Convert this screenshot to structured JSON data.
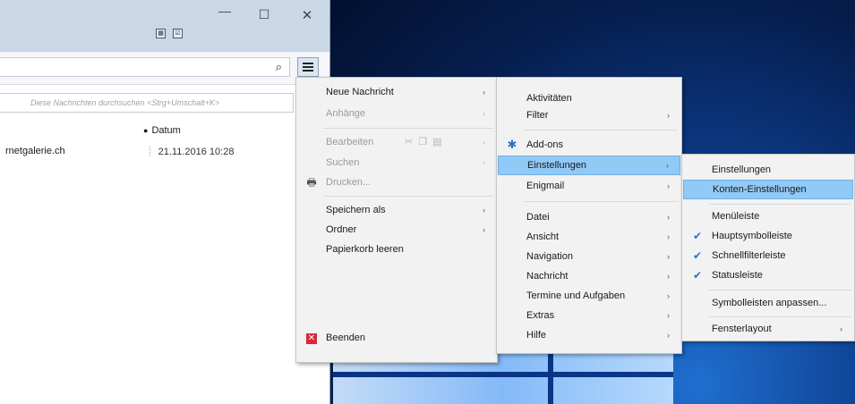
{
  "window": {
    "controls": {
      "minimize": "—",
      "maximize": "☐",
      "close": "✕"
    }
  },
  "toolbar": {
    "search_placeholder": "Diese Nachrichten durchsuchen <Strg+Umschalt+K>"
  },
  "message_list": {
    "date_header": "Datum",
    "rows": [
      {
        "sender": "rnetgalerie.ch",
        "date": "21.11.2016 10:28"
      }
    ]
  },
  "menu_main": [
    {
      "label": "Neue Nachricht",
      "disabled": false,
      "submenu": true
    },
    {
      "label": "Anhänge",
      "disabled": true,
      "submenu": true
    },
    {
      "label": "Bearbeiten",
      "disabled": true,
      "submenu": true
    },
    {
      "label": "Suchen",
      "disabled": true,
      "submenu": true
    },
    {
      "label": "Drucken...",
      "disabled": true,
      "submenu": false
    },
    {
      "label": "Speichern als",
      "disabled": false,
      "submenu": true
    },
    {
      "label": "Ordner",
      "disabled": false,
      "submenu": true
    },
    {
      "label": "Papierkorb leeren",
      "disabled": false,
      "submenu": false
    },
    {
      "label": "Beenden",
      "disabled": false,
      "submenu": false
    }
  ],
  "menu_sub": [
    {
      "label": "Aktivitäten",
      "submenu": false
    },
    {
      "label": "Filter",
      "submenu": true
    },
    {
      "label": "Add-ons",
      "submenu": false
    },
    {
      "label": "Einstellungen",
      "submenu": true,
      "highlighted": true
    },
    {
      "label": "Enigmail",
      "submenu": true
    },
    {
      "label": "Datei",
      "submenu": true
    },
    {
      "label": "Ansicht",
      "submenu": true
    },
    {
      "label": "Navigation",
      "submenu": true
    },
    {
      "label": "Nachricht",
      "submenu": true
    },
    {
      "label": "Termine und Aufgaben",
      "submenu": true
    },
    {
      "label": "Extras",
      "submenu": true
    },
    {
      "label": "Hilfe",
      "submenu": true
    }
  ],
  "menu_settings": [
    {
      "label": "Einstellungen",
      "checked": false,
      "submenu": false
    },
    {
      "label": "Konten-Einstellungen",
      "checked": false,
      "submenu": false,
      "highlighted": true
    },
    {
      "label": "Menüleiste",
      "checked": false,
      "submenu": false
    },
    {
      "label": "Hauptsymbolleiste",
      "checked": true,
      "submenu": false
    },
    {
      "label": "Schnellfilterleiste",
      "checked": true,
      "submenu": false
    },
    {
      "label": "Statusleiste",
      "checked": true,
      "submenu": false
    },
    {
      "label": "Symbolleisten anpassen...",
      "checked": false,
      "submenu": false
    },
    {
      "label": "Fensterlayout",
      "checked": false,
      "submenu": true
    }
  ],
  "colors": {
    "highlight": "#91c9f7",
    "check": "#2b73c8",
    "quit": "#d9283a"
  }
}
